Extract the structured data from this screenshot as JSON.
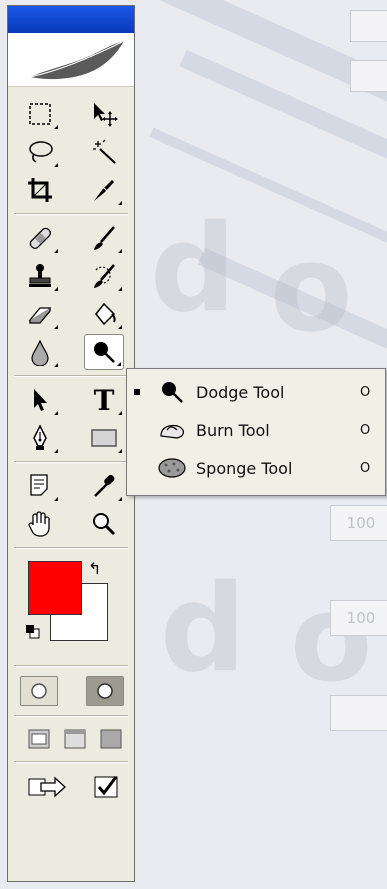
{
  "toolbox": {
    "tools": [
      {
        "name": "rectangular-marquee-tool",
        "icon": "marquee-icon"
      },
      {
        "name": "move-tool",
        "icon": "move-icon"
      },
      {
        "name": "lasso-tool",
        "icon": "lasso-icon"
      },
      {
        "name": "magic-wand-tool",
        "icon": "magic-wand-icon"
      },
      {
        "name": "crop-tool",
        "icon": "crop-icon"
      },
      {
        "name": "slice-tool",
        "icon": "slice-icon"
      },
      {
        "name": "healing-brush-tool",
        "icon": "bandage-icon"
      },
      {
        "name": "brush-tool",
        "icon": "brush-icon"
      },
      {
        "name": "clone-stamp-tool",
        "icon": "stamp-icon"
      },
      {
        "name": "history-brush-tool",
        "icon": "history-brush-icon"
      },
      {
        "name": "eraser-tool",
        "icon": "eraser-icon"
      },
      {
        "name": "paint-bucket-tool",
        "icon": "paint-bucket-icon"
      },
      {
        "name": "blur-tool",
        "icon": "drop-icon"
      },
      {
        "name": "dodge-tool",
        "icon": "dodge-icon"
      },
      {
        "name": "path-selection-tool",
        "icon": "arrow-icon"
      },
      {
        "name": "type-tool",
        "icon": "type-icon"
      },
      {
        "name": "pen-tool",
        "icon": "pen-icon"
      },
      {
        "name": "rectangle-tool",
        "icon": "rectangle-icon"
      },
      {
        "name": "notes-tool",
        "icon": "note-icon"
      },
      {
        "name": "eyedropper-tool",
        "icon": "eyedropper-icon"
      },
      {
        "name": "hand-tool",
        "icon": "hand-icon"
      },
      {
        "name": "zoom-tool",
        "icon": "magnifier-icon"
      }
    ],
    "type_tool_glyph": "T",
    "foreground_color": "#ff0000",
    "background_color": "#ffffff",
    "swap_glyph": "↰"
  },
  "flyout": {
    "items": [
      {
        "label": "Dodge Tool",
        "key": "O",
        "selected": true,
        "icon": "dodge-icon"
      },
      {
        "label": "Burn Tool",
        "key": "O",
        "selected": false,
        "icon": "burn-icon"
      },
      {
        "label": "Sponge Tool",
        "key": "O",
        "selected": false,
        "icon": "sponge-icon"
      }
    ]
  },
  "background": {
    "field_values": [
      "100",
      "100"
    ]
  }
}
